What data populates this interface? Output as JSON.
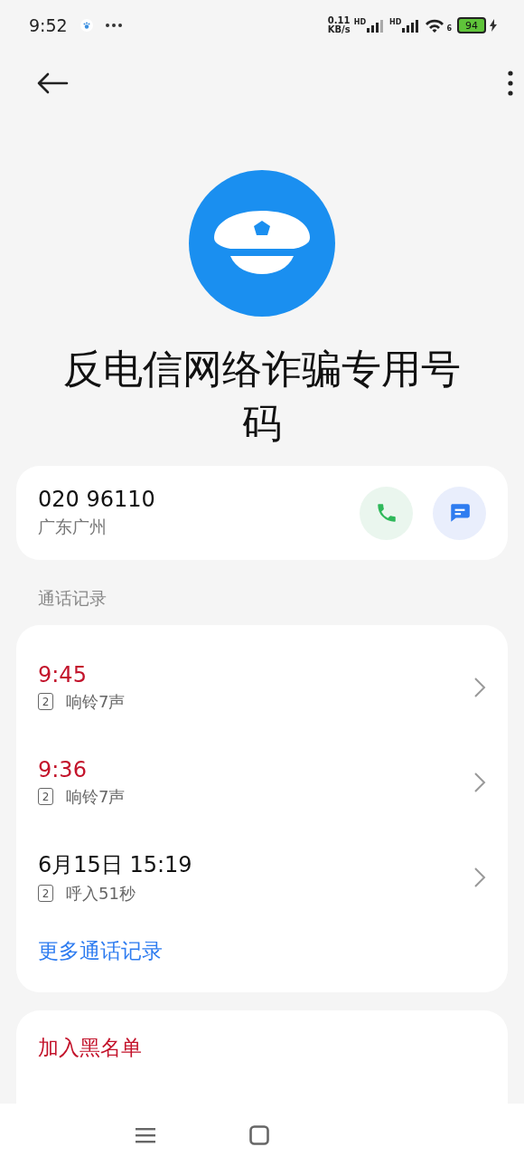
{
  "status_bar": {
    "time": "9:52",
    "speed_value": "0.11",
    "speed_unit": "KB/s",
    "sim_labels": [
      "HD",
      "HD"
    ],
    "wifi_label": "6",
    "battery": "94"
  },
  "contact": {
    "name": "反电信网络诈骗专用号码"
  },
  "number_card": {
    "number": "020 96110",
    "location": "广东广州"
  },
  "call_log": {
    "heading": "通话记录",
    "entries": [
      {
        "time": "9:45",
        "missed": true,
        "sim": "2",
        "detail": "响铃7声"
      },
      {
        "time": "9:36",
        "missed": true,
        "sim": "2",
        "detail": "响铃7声"
      },
      {
        "time": "6月15日 15:19",
        "missed": false,
        "sim": "2",
        "detail": "呼入51秒"
      }
    ],
    "more_link": "更多通话记录"
  },
  "actions": [
    "加入黑名单"
  ]
}
